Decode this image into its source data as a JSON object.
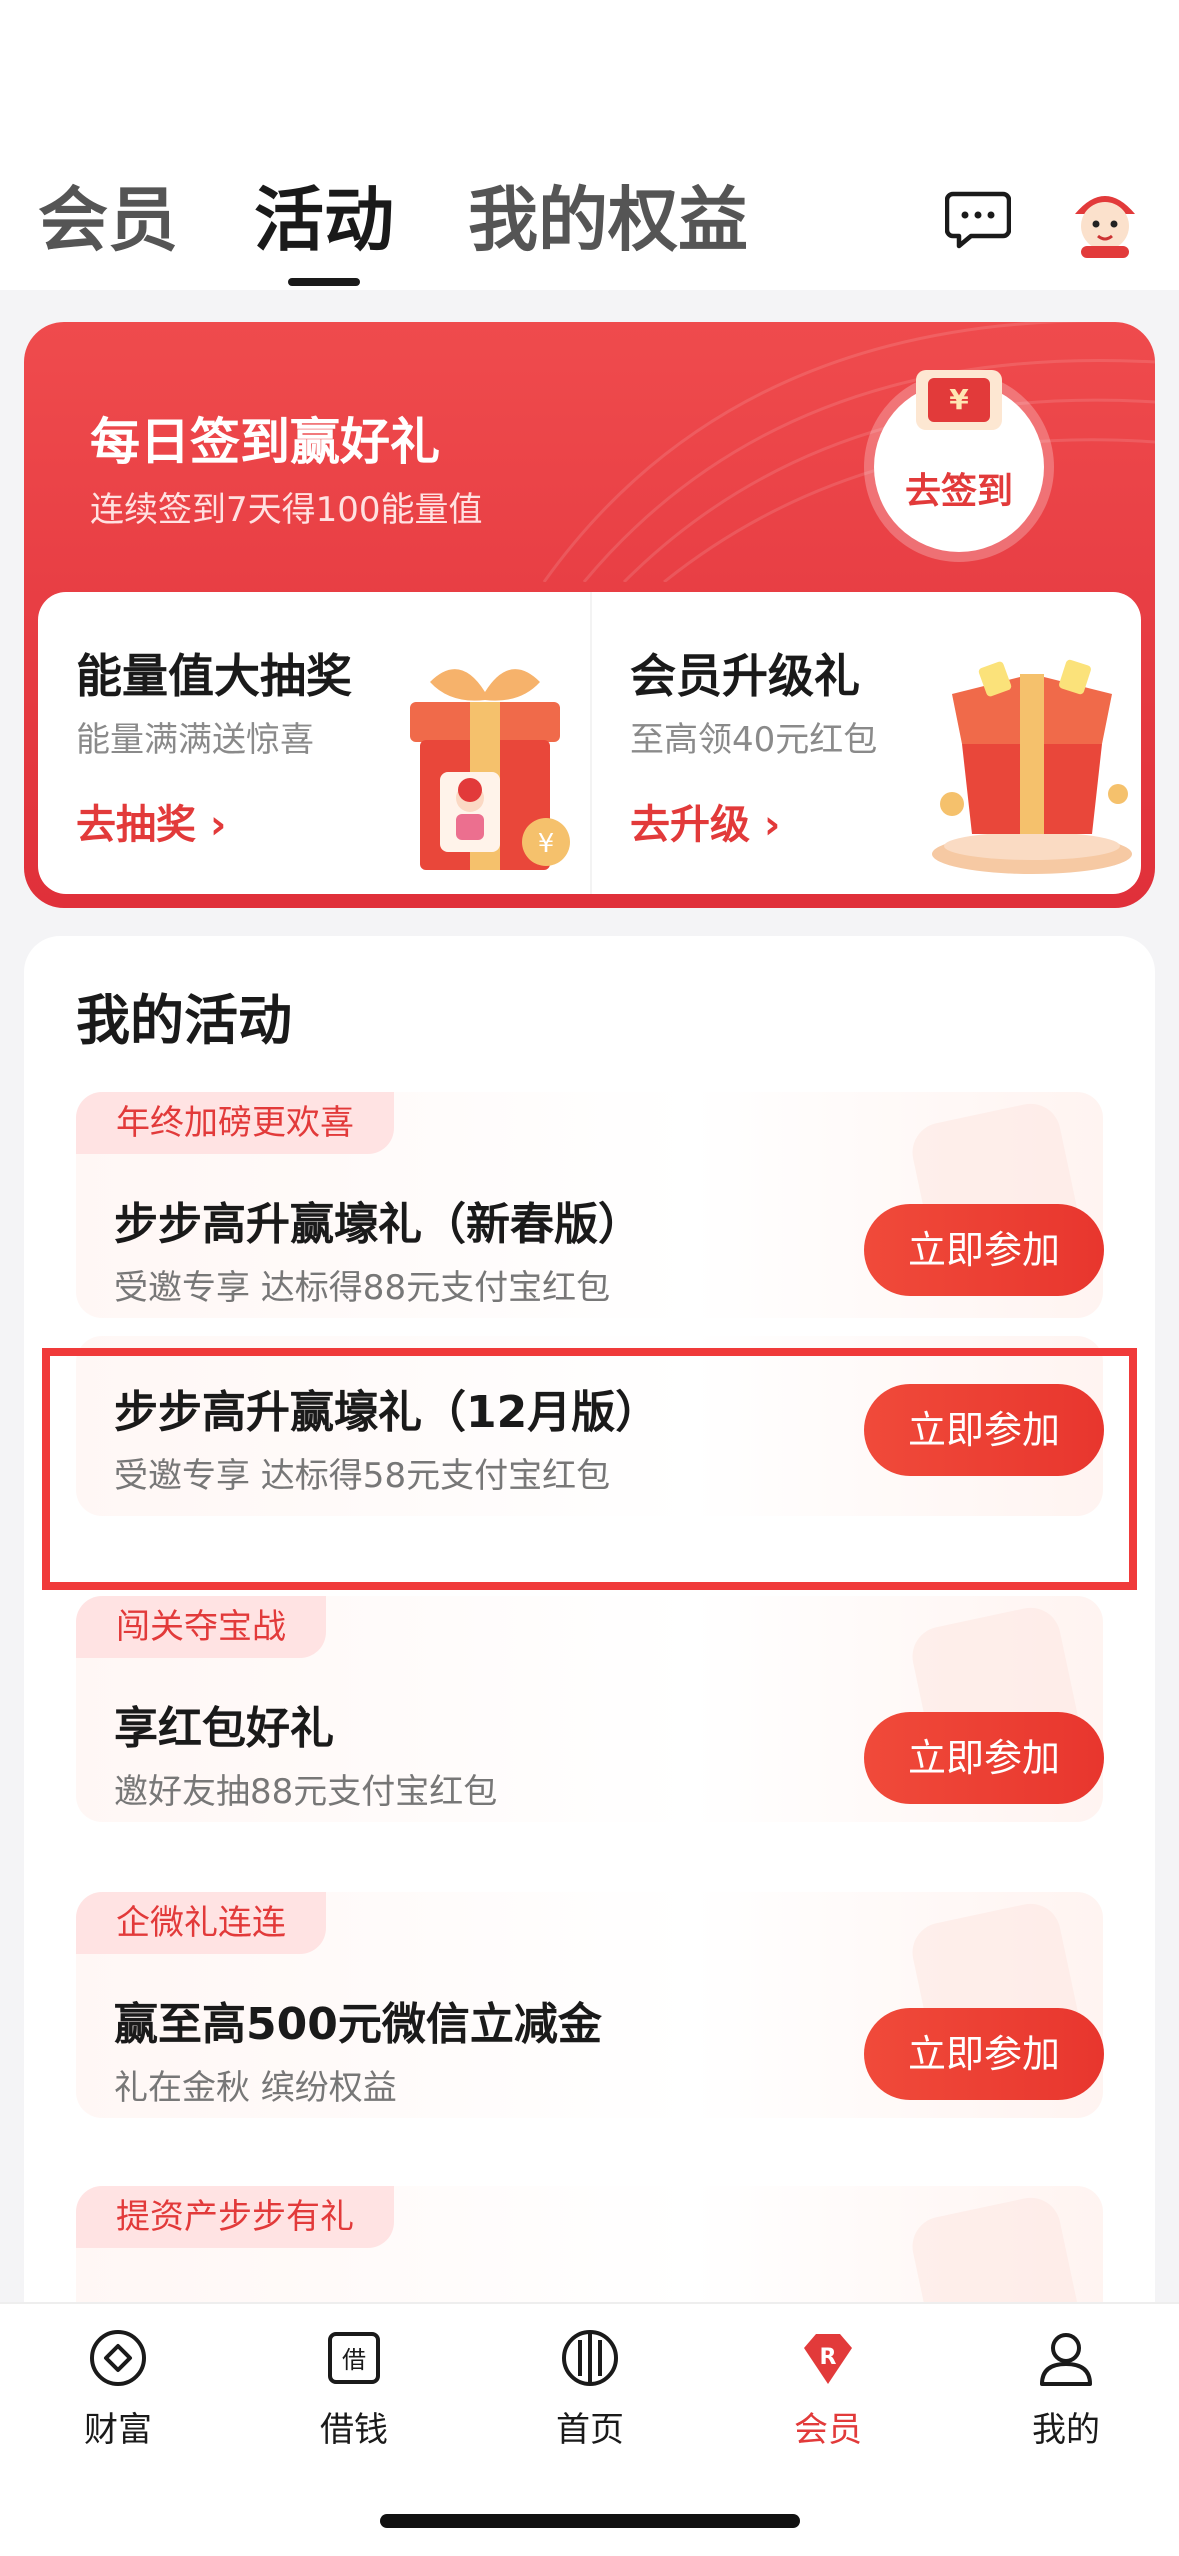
{
  "top_tabs": [
    "会员",
    "活动",
    "我的权益"
  ],
  "active_tab": "活动",
  "banner": {
    "title": "每日签到赢好礼",
    "subtitle": "连续签到7天得100能量值",
    "sign_button": "去签到",
    "envelope_symbol": "¥",
    "left_card": {
      "title": "能量值大抽奖",
      "subtitle": "能量满满送惊喜",
      "link": "去抽奖 ›"
    },
    "right_card": {
      "title": "会员升级礼",
      "subtitle": "至高领40元红包",
      "link": "去升级 ›"
    }
  },
  "activities": {
    "title": "我的活动",
    "items": [
      {
        "tag": "年终加磅更欢喜",
        "title": "步步高升赢壕礼（新春版）",
        "subtitle": "受邀专享 达标得88元支付宝红包",
        "button": "立即参加"
      },
      {
        "tag": "",
        "title": "步步高升赢壕礼（12月版）",
        "subtitle": "受邀专享 达标得58元支付宝红包",
        "button": "立即参加"
      },
      {
        "tag": "闯关夺宝战",
        "title": "享红包好礼",
        "subtitle": "邀好友抽88元支付宝红包",
        "button": "立即参加"
      },
      {
        "tag": "企微礼连连",
        "title": "赢至高500元微信立减金",
        "subtitle": "礼在金秋 缤纷权益",
        "button": "立即参加"
      },
      {
        "tag": "提资产步步有礼",
        "title": "",
        "subtitle": "",
        "button": ""
      }
    ]
  },
  "bottom_nav": {
    "items": [
      {
        "label": "财富",
        "icon": "wealth-icon"
      },
      {
        "label": "借钱",
        "icon": "borrow-icon"
      },
      {
        "label": "首页",
        "icon": "home-icon"
      },
      {
        "label": "会员",
        "icon": "member-icon"
      },
      {
        "label": "我的",
        "icon": "profile-icon"
      }
    ],
    "active": "会员"
  },
  "colors": {
    "accent": "#e23a3a",
    "highlight_border": "#f03a3a"
  }
}
